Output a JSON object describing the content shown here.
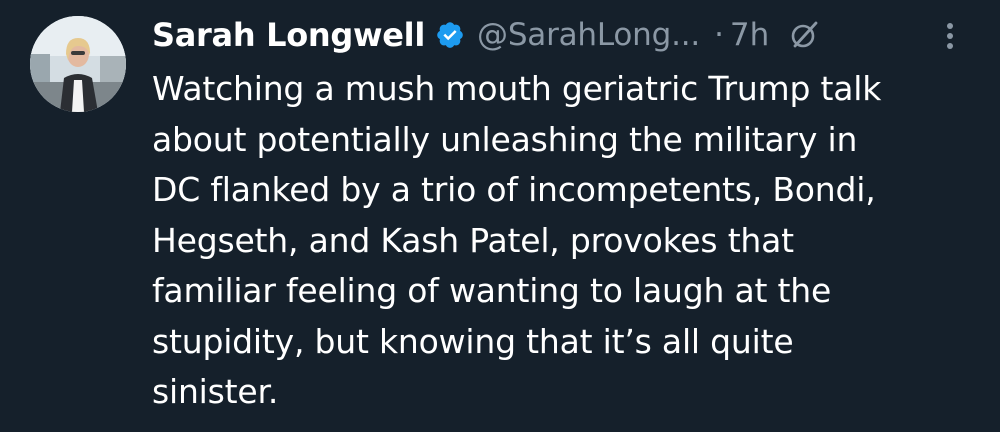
{
  "author": {
    "name": "Sarah Longwell",
    "handle": "@SarahLong...",
    "separator": "·",
    "time": "7h"
  },
  "icons": {
    "avatar": "profile-photo",
    "verified": "verified-badge-icon",
    "grok": "grok-icon",
    "more": "more-options-icon"
  },
  "colors": {
    "background": "#15202b",
    "verified": "#1d9bf0",
    "secondary_text": "#8b98a5"
  },
  "tweet": {
    "lines": [
      "Watching a mush mouth geriatric Trump talk",
      "about potentially unleashing the military in",
      "DC flanked by a trio of incompetents, Bondi,",
      "Hegseth, and Kash Patel, provokes that",
      "familiar feeling of wanting to laugh at the",
      "stupidity, but knowing that it’s all quite",
      "sinister."
    ]
  }
}
